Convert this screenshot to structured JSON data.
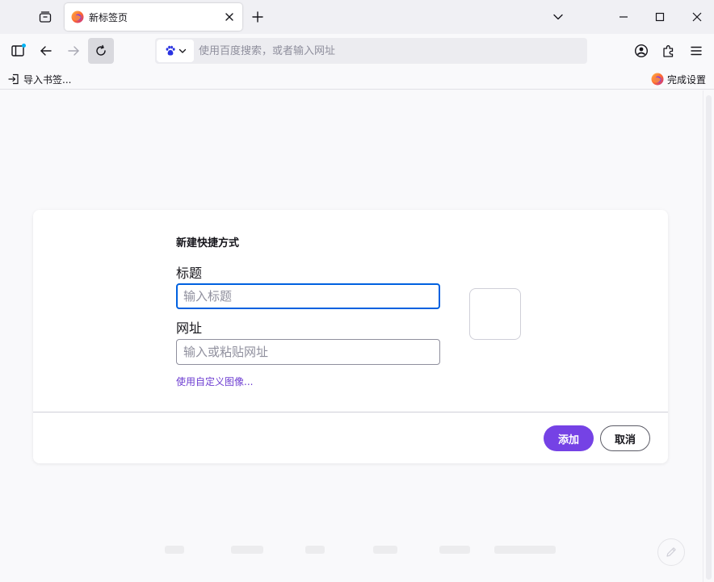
{
  "tabs": [
    {
      "title": "新标签页"
    }
  ],
  "urlbar": {
    "placeholder": "使用百度搜索，或者输入网址"
  },
  "bookmarks": {
    "import_label": "导入书签...",
    "setup_label": "完成设置"
  },
  "dialog": {
    "title": "新建快捷方式",
    "title_label": "标题",
    "title_placeholder": "输入标题",
    "url_label": "网址",
    "url_placeholder": "输入或粘贴网址",
    "custom_image_link": "使用自定义图像...",
    "add_label": "添加",
    "cancel_label": "取消"
  },
  "colors": {
    "accent": "#7542e5",
    "focus_ring": "#0061e0",
    "link": "#6d3dd1"
  },
  "icons": {
    "tab_list": "tab-list-icon",
    "favicon": "firefox-icon",
    "close_tab": "close-icon",
    "new_tab": "plus-icon",
    "overflow": "chevron-down-icon",
    "sidebar": "sidebar-icon",
    "back": "back-arrow-icon",
    "forward": "forward-arrow-icon",
    "reload": "reload-icon",
    "search_engine": "baidu-paw-icon",
    "account": "account-icon",
    "extensions": "puzzle-icon",
    "menu": "hamburger-menu-icon",
    "import": "import-icon",
    "edit": "pencil-icon"
  }
}
